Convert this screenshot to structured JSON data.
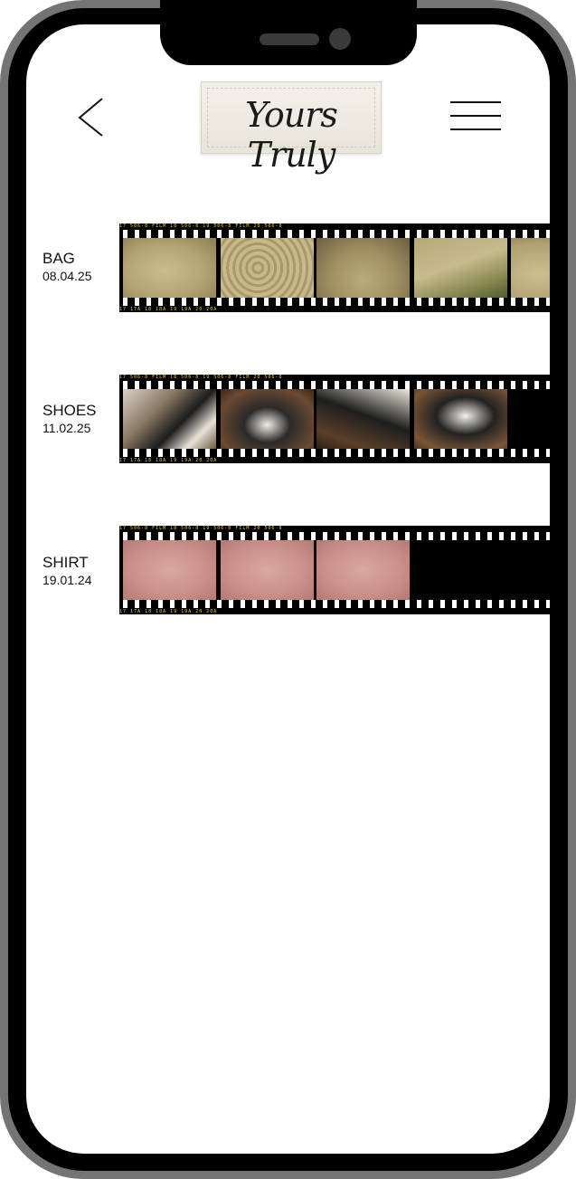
{
  "header": {
    "logo_text": "Yours Truly",
    "back_icon": "chevron-left-icon",
    "menu_icon": "hamburger-menu-icon"
  },
  "items": [
    {
      "title": "BAG",
      "date": "08.04.25",
      "frames": 5
    },
    {
      "title": "SHOES",
      "date": "11.02.25",
      "frames": 4
    },
    {
      "title": "SHIRT",
      "date": "19.01.24",
      "frames": 3
    }
  ],
  "film": {
    "edge_top": "17      506-8 FILM          18      506-8          19      506-8 FILM          20      506-8",
    "edge_bottom": "17       17A       18       18A       19       19A       20       20A"
  },
  "colors": {
    "frame_black": "#000000",
    "film_text": "#e6d04a",
    "phone_gray": "#747474"
  }
}
